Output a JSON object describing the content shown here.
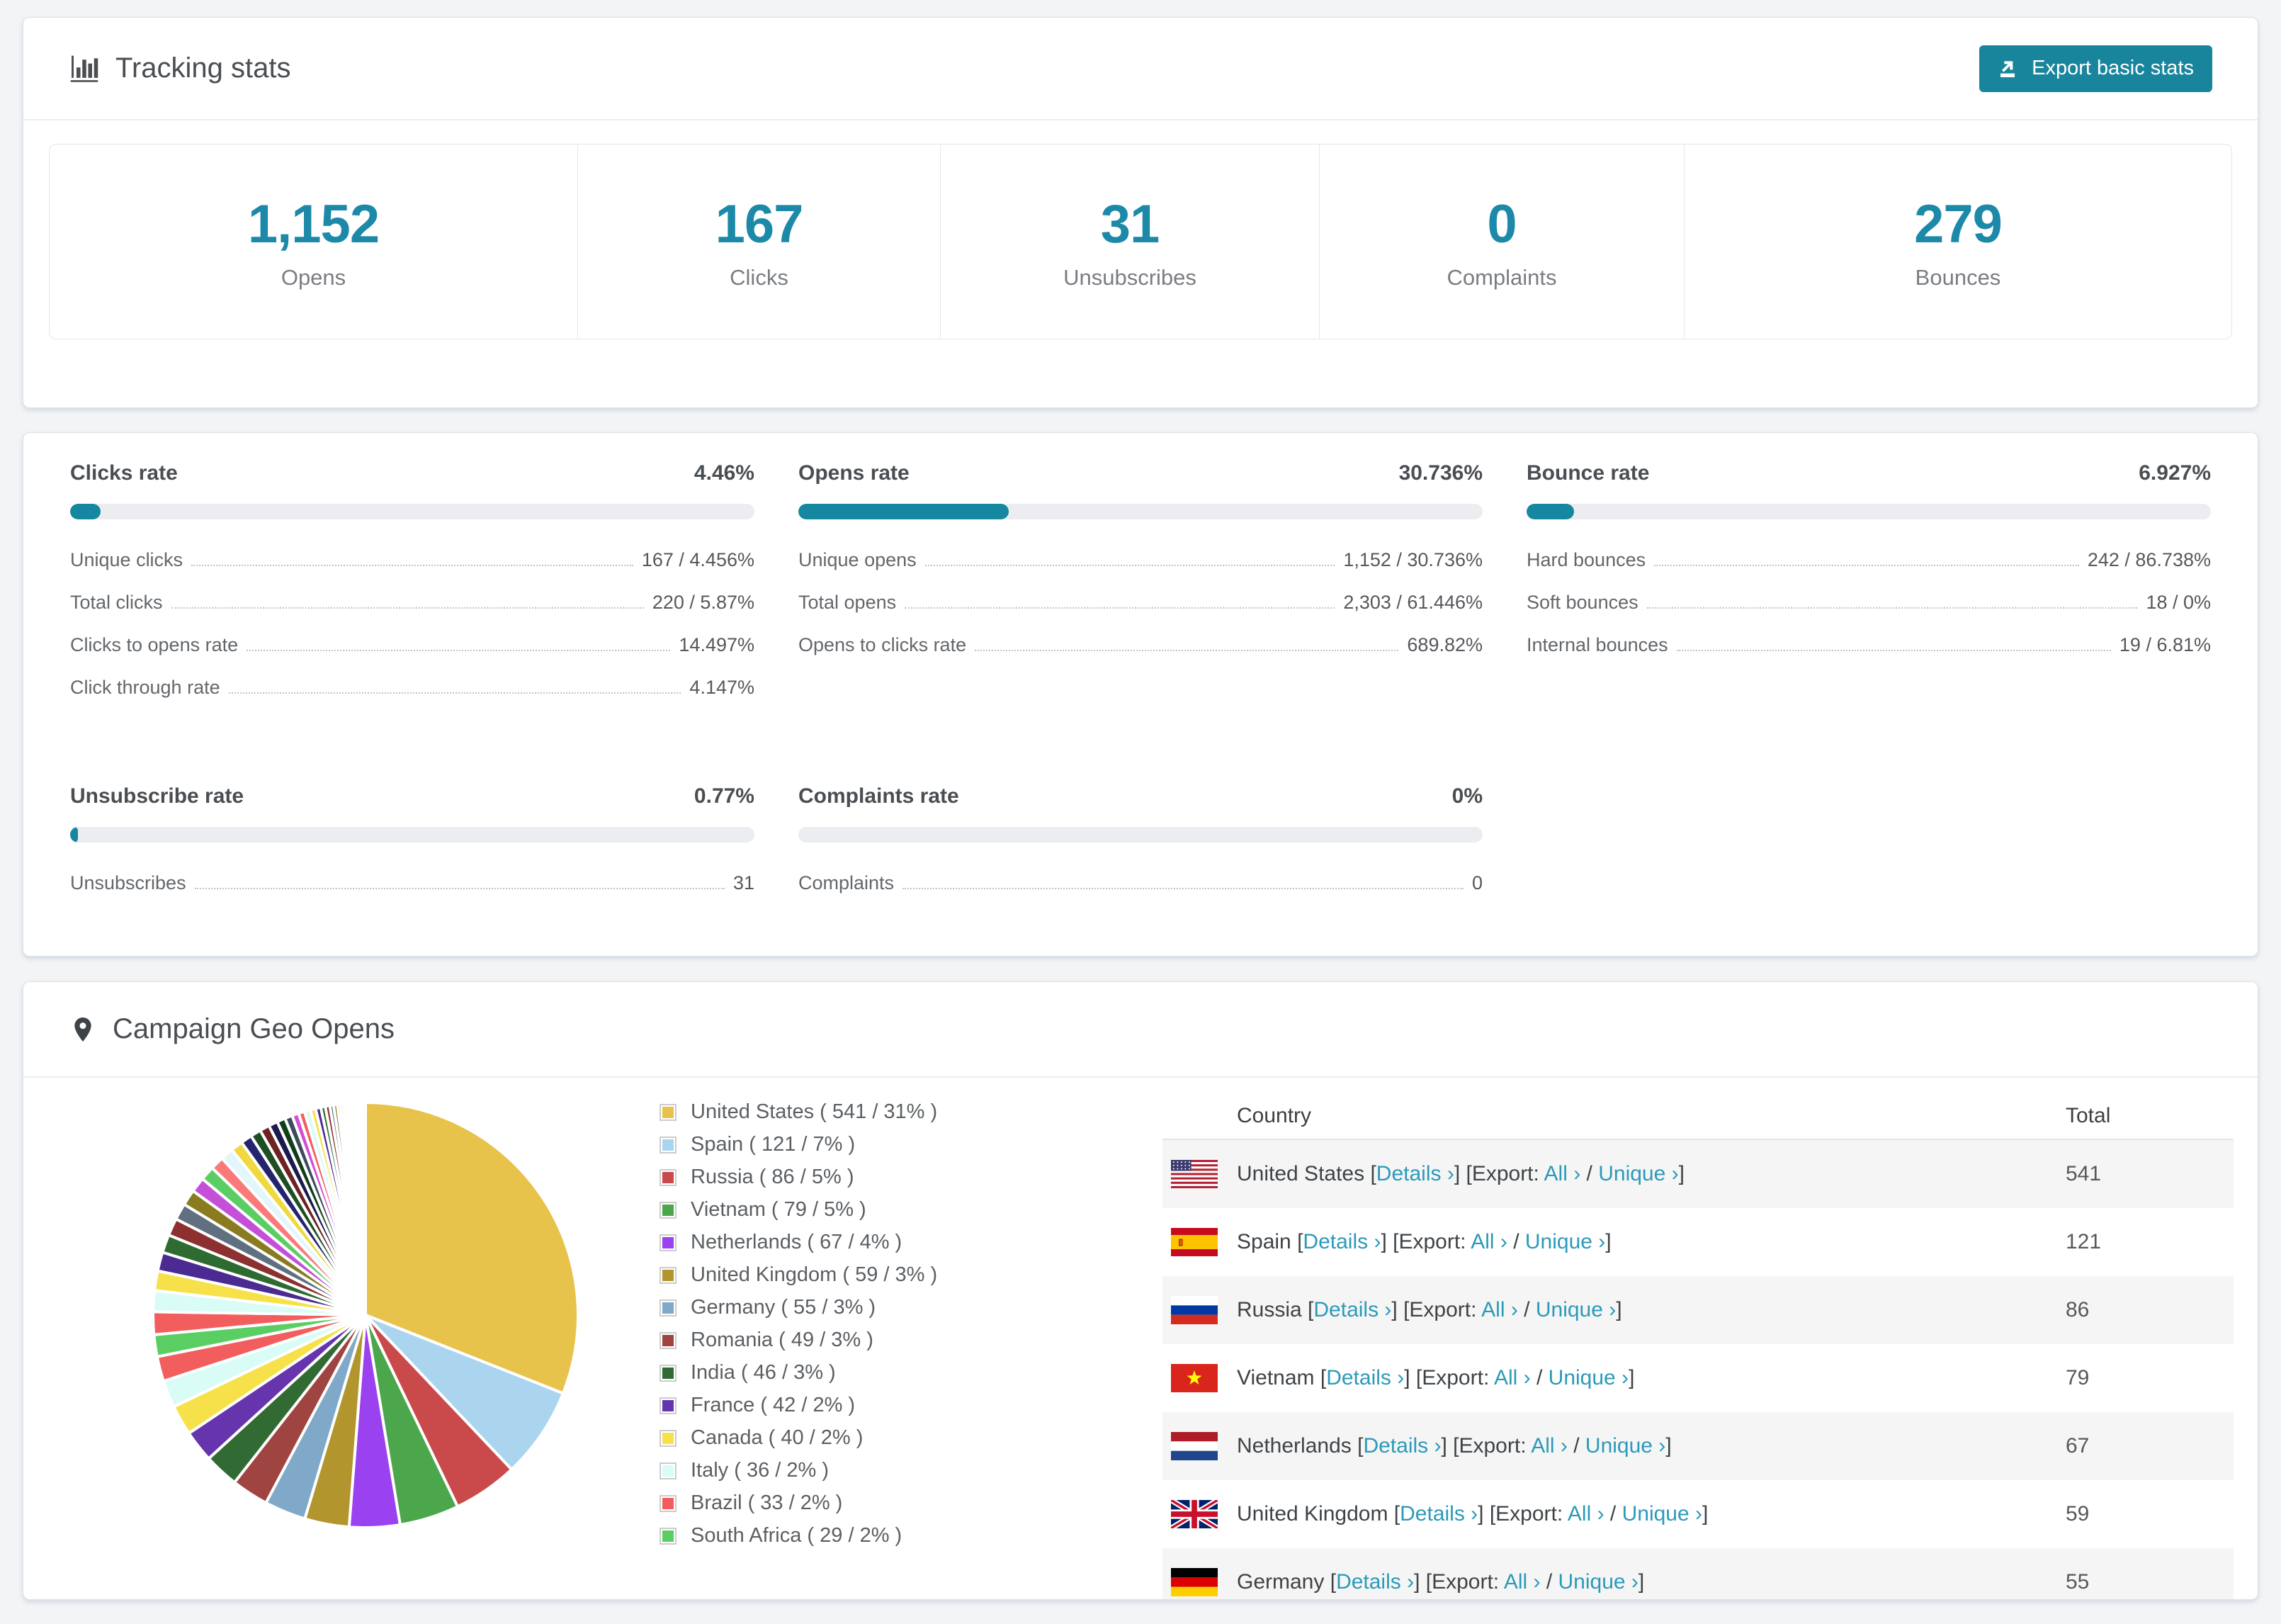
{
  "colors": {
    "accent": "#1d89a8",
    "button": "#18859d",
    "bar_fill": "#1587a1",
    "link": "#2b9ab9",
    "row_alt": "#f5f5f5"
  },
  "tracking": {
    "title": "Tracking stats",
    "export_button": "Export basic stats",
    "stats": [
      {
        "value": "1,152",
        "label": "Opens"
      },
      {
        "value": "167",
        "label": "Clicks"
      },
      {
        "value": "31",
        "label": "Unsubscribes"
      },
      {
        "value": "0",
        "label": "Complaints"
      },
      {
        "value": "279",
        "label": "Bounces"
      }
    ]
  },
  "rates": {
    "sections": [
      {
        "title": "Clicks rate",
        "value": "4.46%",
        "bar_pct": 4.46,
        "rows": [
          {
            "label": "Unique clicks",
            "value": "167 / 4.456%"
          },
          {
            "label": "Total clicks",
            "value": "220 / 5.87%"
          },
          {
            "label": "Clicks to opens rate",
            "value": "14.497%"
          },
          {
            "label": "Click through rate",
            "value": "4.147%"
          }
        ]
      },
      {
        "title": "Opens rate",
        "value": "30.736%",
        "bar_pct": 30.736,
        "rows": [
          {
            "label": "Unique opens",
            "value": "1,152 / 30.736%"
          },
          {
            "label": "Total opens",
            "value": "2,303 / 61.446%"
          },
          {
            "label": "Opens to clicks rate",
            "value": "689.82%"
          }
        ]
      },
      {
        "title": "Bounce rate",
        "value": "6.927%",
        "bar_pct": 6.927,
        "rows": [
          {
            "label": "Hard bounces",
            "value": "242 / 86.738%"
          },
          {
            "label": "Soft bounces",
            "value": "18 / 0%"
          },
          {
            "label": "Internal bounces",
            "value": "19 / 6.81%"
          }
        ]
      },
      {
        "title": "Unsubscribe rate",
        "value": "0.77%",
        "bar_pct": 0.77,
        "rows": [
          {
            "label": "Unsubscribes",
            "value": "31"
          }
        ]
      },
      {
        "title": "Complaints rate",
        "value": "0%",
        "bar_pct": 0,
        "rows": [
          {
            "label": "Complaints",
            "value": "0"
          }
        ]
      }
    ]
  },
  "geo": {
    "title": "Campaign Geo Opens",
    "table": {
      "headers": [
        "Country",
        "Total"
      ],
      "link_labels": {
        "details": "Details",
        "export_prefix": "Export:",
        "all": "All",
        "unique": "Unique",
        "chevron": "›"
      },
      "punct": {
        "open": "[",
        "close": "]",
        "slash": "/"
      },
      "rows": [
        {
          "country": "United States",
          "flag": "us",
          "total": "541"
        },
        {
          "country": "Spain",
          "flag": "es",
          "total": "121"
        },
        {
          "country": "Russia",
          "flag": "ru",
          "total": "86"
        },
        {
          "country": "Vietnam",
          "flag": "vn",
          "total": "79"
        },
        {
          "country": "Netherlands",
          "flag": "nl",
          "total": "67"
        },
        {
          "country": "United Kingdom",
          "flag": "gb",
          "total": "59"
        },
        {
          "country": "Germany",
          "flag": "de",
          "total": "55"
        }
      ]
    }
  },
  "chart_data": {
    "type": "pie",
    "title": "Campaign Geo Opens",
    "legend_position": "right-of-pie",
    "start_angle_deg": 0,
    "direction": "clockwise",
    "total_estimated": 1745,
    "series": [
      {
        "name": "United States",
        "value": 541,
        "pct": 31,
        "color": "#e8c34b"
      },
      {
        "name": "Spain",
        "value": 121,
        "pct": 7,
        "color": "#abd4ef"
      },
      {
        "name": "Russia",
        "value": 86,
        "pct": 5,
        "color": "#ca4a4c"
      },
      {
        "name": "Vietnam",
        "value": 79,
        "pct": 5,
        "color": "#4ca74c"
      },
      {
        "name": "Netherlands",
        "value": 67,
        "pct": 4,
        "color": "#9a41f0"
      },
      {
        "name": "United Kingdom",
        "value": 59,
        "pct": 3,
        "color": "#b2952c"
      },
      {
        "name": "Germany",
        "value": 55,
        "pct": 3,
        "color": "#7fa8c9"
      },
      {
        "name": "Romania",
        "value": 49,
        "pct": 3,
        "color": "#a04441"
      },
      {
        "name": "India",
        "value": 46,
        "pct": 3,
        "color": "#316b33"
      },
      {
        "name": "France",
        "value": 42,
        "pct": 2,
        "color": "#6635ad"
      },
      {
        "name": "Canada",
        "value": 40,
        "pct": 2,
        "color": "#f6e14b"
      },
      {
        "name": "Italy",
        "value": 36,
        "pct": 2,
        "color": "#d9fcf6"
      },
      {
        "name": "Brazil",
        "value": 33,
        "pct": 2,
        "color": "#f25e5e"
      },
      {
        "name": "South Africa",
        "value": 29,
        "pct": 2,
        "color": "#5bce63"
      }
    ],
    "others_tail_values": [
      30,
      28,
      26,
      25,
      24,
      23,
      22,
      21,
      20,
      19,
      18,
      17,
      16,
      15,
      14,
      13,
      12,
      11,
      10,
      9,
      8,
      8,
      7,
      7,
      6,
      6,
      5,
      5,
      4,
      4,
      3,
      3,
      3,
      2,
      2,
      2,
      2,
      1,
      1,
      1,
      1,
      1,
      1,
      1,
      1,
      1,
      1,
      1,
      1
    ],
    "others_tail_palette": [
      "#f25e5e",
      "#d9fcf6",
      "#f6e14b",
      "#4b2a91",
      "#2e6b30",
      "#8c3030",
      "#607080",
      "#8a7a20",
      "#c44fd9",
      "#5bce63",
      "#fa7a7a",
      "#e3f6fc",
      "#f0d840",
      "#24246e",
      "#1d4f22",
      "#6e2222",
      "#1a1a4e",
      "#123d1a",
      "#3c4c5c",
      "#d24fd2"
    ]
  }
}
